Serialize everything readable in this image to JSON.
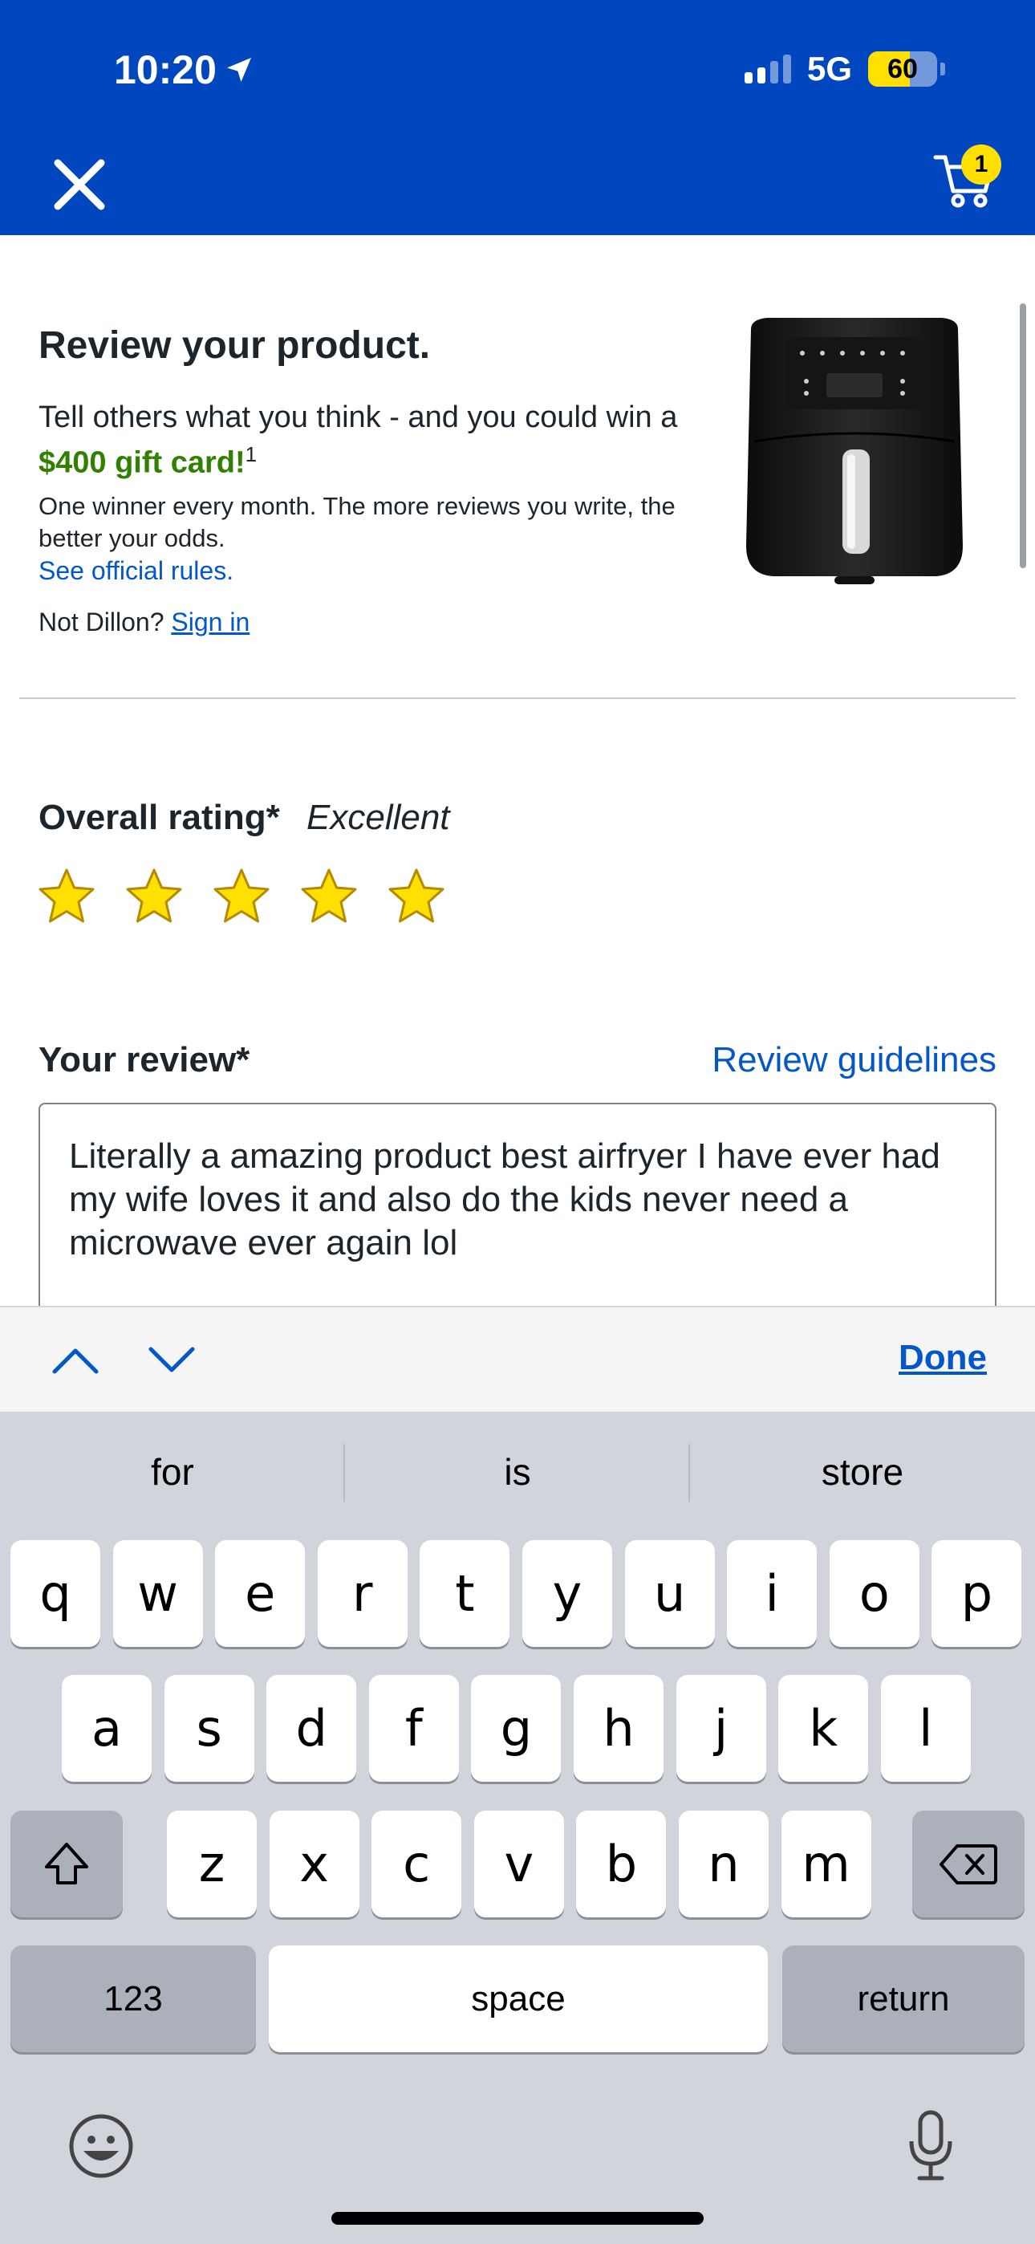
{
  "status_bar": {
    "time": "10:20",
    "network": "5G",
    "battery_percent": 60,
    "battery_label": "60"
  },
  "header": {
    "cart_count": "1"
  },
  "promo": {
    "title": "Review your product.",
    "body_text": "Tell others what you think - and you could win a ",
    "prize": "$400 gift card!",
    "footnote": "1",
    "details": "One winner every month. The more reviews you write, the better your odds.",
    "rules_link": "See official rules.",
    "not_user_text": "Not Dillon?",
    "sign_in_link": "Sign in"
  },
  "rating": {
    "label": "Overall rating*",
    "value_text": "Excellent",
    "stars_filled": 5,
    "stars_total": 5
  },
  "review": {
    "label": "Your review*",
    "guidelines_link": "Review guidelines",
    "text": "Literally a amazing product best airfryer I have ever had my wife loves it and also do the kids never need a microwave ever again lol"
  },
  "accessory": {
    "done_label": "Done"
  },
  "keyboard": {
    "suggestions": [
      "for",
      "is",
      "store"
    ],
    "row1": [
      "q",
      "w",
      "e",
      "r",
      "t",
      "y",
      "u",
      "i",
      "o",
      "p"
    ],
    "row2": [
      "a",
      "s",
      "d",
      "f",
      "g",
      "h",
      "j",
      "k",
      "l"
    ],
    "row3": [
      "z",
      "x",
      "c",
      "v",
      "b",
      "n",
      "m"
    ],
    "numbers_label": "123",
    "space_label": "space",
    "return_label": "return"
  },
  "colors": {
    "brand_blue": "#0046be",
    "accent_yellow": "#ffe000",
    "prize_green": "#318000",
    "link_blue": "#0457c8"
  }
}
